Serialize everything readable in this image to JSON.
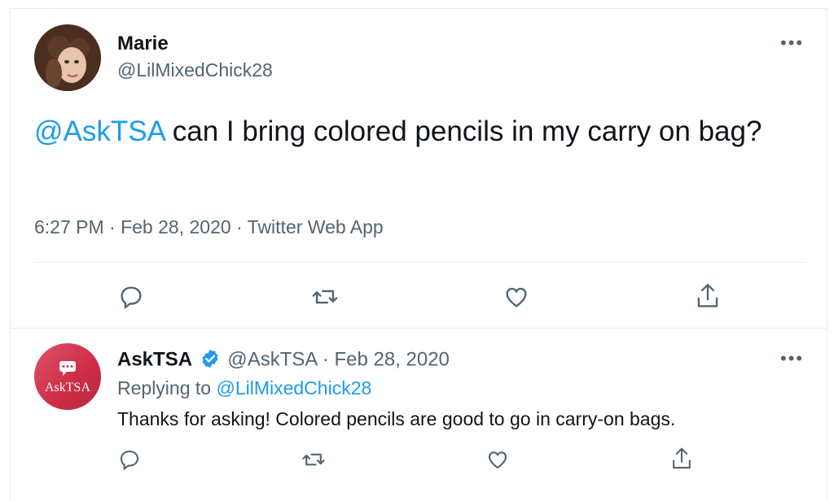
{
  "tweet": {
    "author_name": "Marie",
    "author_handle": "@LilMixedChick28",
    "mention": "@AskTSA",
    "text": " can I bring colored pencils in my carry on bag?",
    "timestamp": "6:27 PM · Feb 28, 2020 · Twitter Web App",
    "actions": [
      "reply-icon",
      "retweet-icon",
      "like-icon",
      "share-icon"
    ],
    "more_label": "•••"
  },
  "reply": {
    "author_name": "AskTSA",
    "author_handle": "@AskTSA",
    "date": "· Feb 28, 2020",
    "replying_prefix": "Replying to ",
    "replying_to": "@LilMixedChick28",
    "text": "Thanks for asking! Colored pencils are good to go in carry-on bags.",
    "avatar_label": "AskTSA",
    "verified_icon": "verified-badge-icon",
    "actions": [
      "reply-icon",
      "retweet-icon",
      "like-icon",
      "share-icon"
    ],
    "more_label": "•••"
  },
  "colors": {
    "link": "#1d9bf0",
    "secondary_text": "#536471",
    "verified": "#1d9bf0",
    "asktsa_avatar": "#d83b52"
  }
}
